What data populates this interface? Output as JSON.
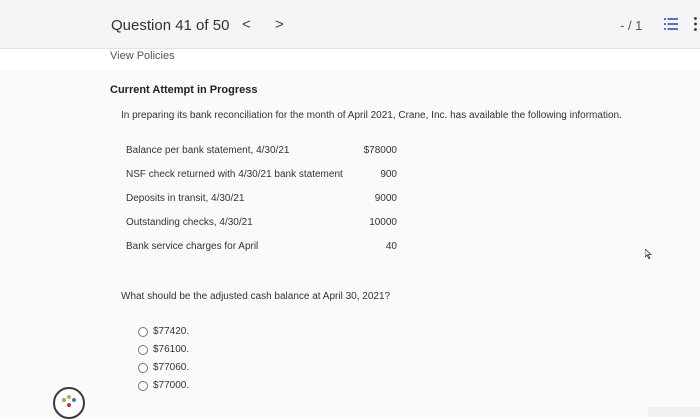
{
  "header": {
    "question_label": "Question 41 of 50",
    "prev_glyph": "<",
    "next_glyph": ">",
    "score": "- / 1",
    "list_icon": "list-icon",
    "more_icon": "more-vertical-icon"
  },
  "view_policies": "View Policies",
  "attempt_label": "Current Attempt in Progress",
  "intro": "In preparing its bank reconciliation for the month of April 2021, Crane, Inc. has available the following information.",
  "items": [
    {
      "label": "Balance per bank statement, 4/30/21",
      "value": "$78000"
    },
    {
      "label": "NSF check returned with 4/30/21 bank statement",
      "value": "900"
    },
    {
      "label": "Deposits in transit, 4/30/21",
      "value": "9000"
    },
    {
      "label": "Outstanding checks, 4/30/21",
      "value": "10000"
    },
    {
      "label": "Bank service charges for April",
      "value": "40"
    }
  ],
  "question": "What should be the adjusted cash balance at April 30, 2021?",
  "options": [
    "$77420.",
    "$76100.",
    "$77060.",
    "$77000."
  ],
  "colors": {
    "topbar": "#f4f5f7",
    "content": "#fafafa",
    "text": "#333333"
  }
}
